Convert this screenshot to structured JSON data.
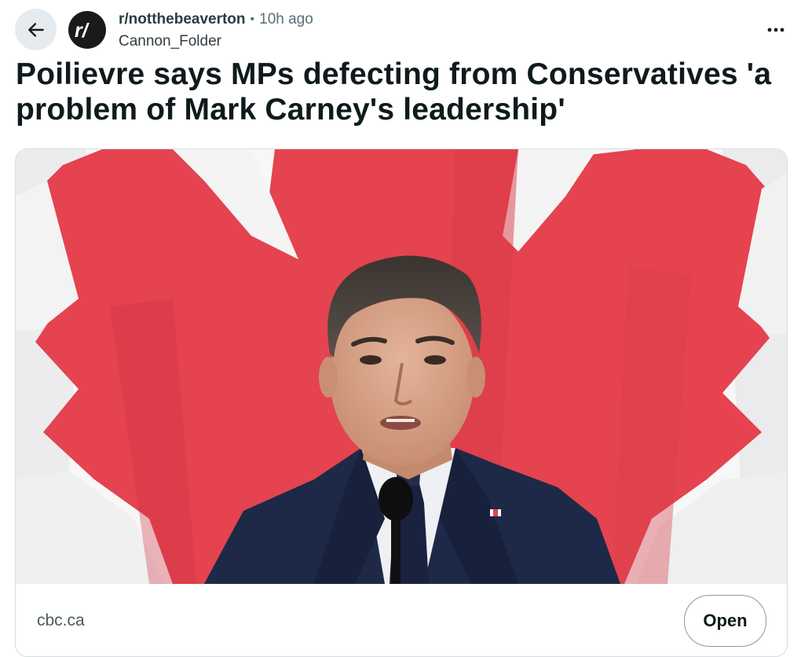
{
  "post": {
    "subreddit": "r/notthebeaverton",
    "separator": "•",
    "time": "10h ago",
    "author": "Cannon_Folder",
    "avatar_text": "r/",
    "title": "Poilievre says MPs defecting from Conservatives 'a problem of Mark Carney's leadership'"
  },
  "link": {
    "domain": "cbc.ca",
    "open_label": "Open"
  },
  "icons": {
    "back": "arrow-left-icon",
    "more": "ellipsis-icon"
  },
  "colors": {
    "flag_red": "#e4434f",
    "suit_navy": "#1d2947",
    "back_bg": "#e5ebee"
  }
}
